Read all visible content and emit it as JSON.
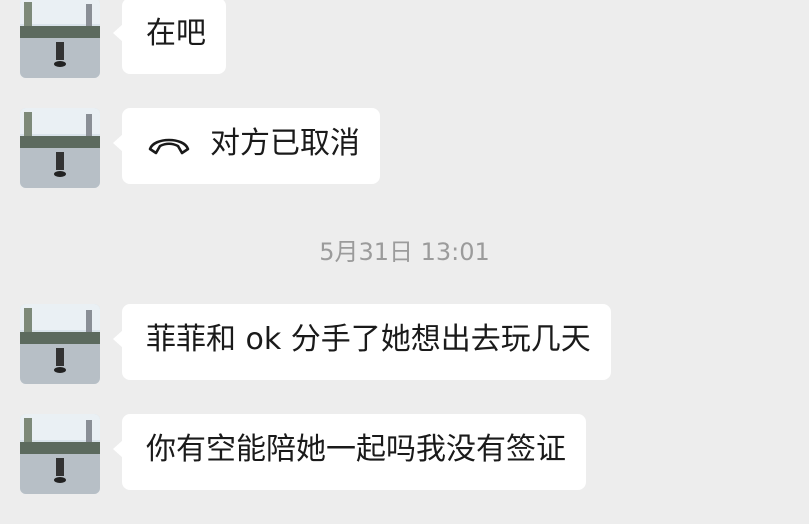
{
  "messages": [
    {
      "sender": "contact",
      "avatar_icon": "profile-photo-icon",
      "text": "在吧"
    },
    {
      "sender": "contact",
      "avatar_icon": "profile-photo-icon",
      "type": "call",
      "call_icon": "phone-hangup-icon",
      "text": "对方已取消"
    },
    {
      "sender": "contact",
      "avatar_icon": "profile-photo-icon",
      "text": "菲菲和 ok 分手了她想出去玩几天"
    },
    {
      "sender": "contact",
      "avatar_icon": "profile-photo-icon",
      "text": "你有空能陪她一起吗我没有签证"
    }
  ],
  "timestamp": "5月31日 13:01",
  "colors": {
    "background": "#ededed",
    "bubble": "#ffffff",
    "text": "#1a1a1a",
    "timestamp": "#9b9b9b"
  }
}
